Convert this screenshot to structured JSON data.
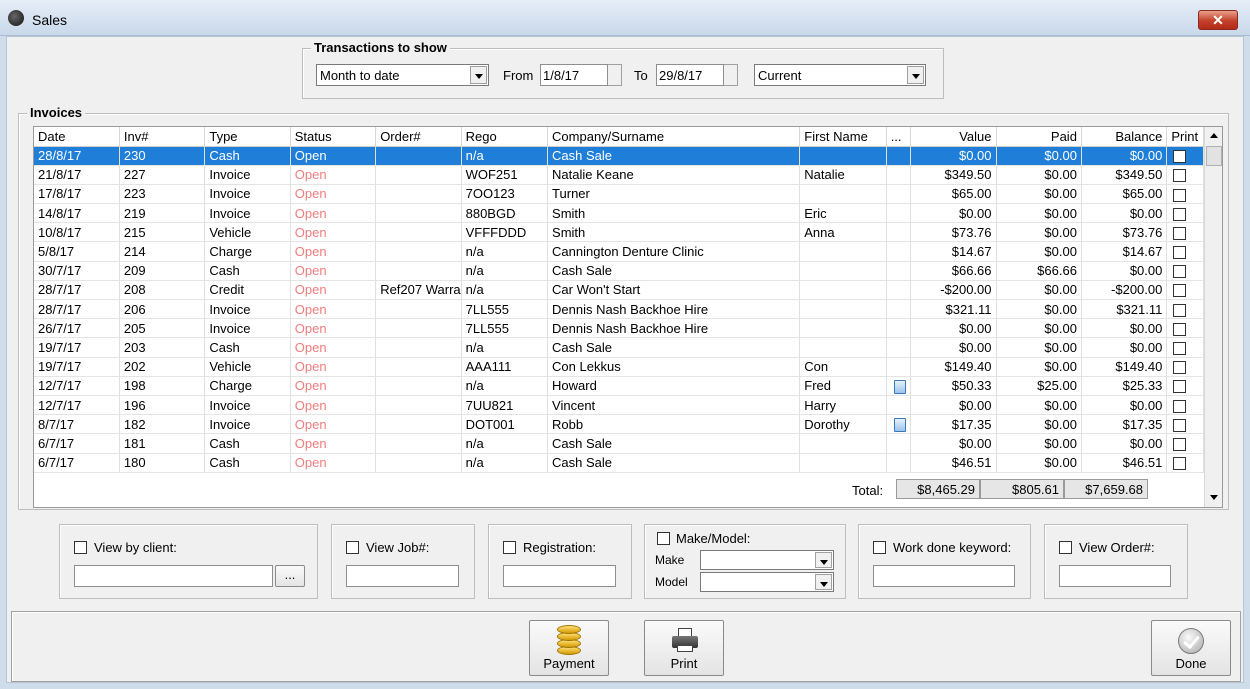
{
  "window": {
    "title": "Sales",
    "close_glyph": "✕"
  },
  "transactions": {
    "legend": "Transactions to show",
    "period": "Month to date",
    "from_label": "From",
    "from_value": "1/8/17",
    "to_label": "To",
    "to_value": "29/8/17",
    "scope": "Current"
  },
  "invoices": {
    "legend": "Invoices",
    "columns": [
      "Date",
      "Inv#",
      "Type",
      "Status",
      "Order#",
      "Rego",
      "Company/Surname",
      "First Name",
      "...",
      "Value",
      "Paid",
      "Balance",
      "Print"
    ],
    "rows": [
      {
        "date": "28/8/17",
        "inv": "230",
        "type": "Cash",
        "status": "Open",
        "order": "",
        "rego": "n/a",
        "company": "Cash Sale",
        "first": "",
        "doc": false,
        "value": "$0.00",
        "paid": "$0.00",
        "balance": "$0.00"
      },
      {
        "date": "21/8/17",
        "inv": "227",
        "type": "Invoice",
        "status": "Open",
        "order": "",
        "rego": "WOF251",
        "company": "Natalie Keane",
        "first": "Natalie",
        "doc": false,
        "value": "$349.50",
        "paid": "$0.00",
        "balance": "$349.50"
      },
      {
        "date": "17/8/17",
        "inv": "223",
        "type": "Invoice",
        "status": "Open",
        "order": "",
        "rego": "7OO123",
        "company": "Turner",
        "first": "",
        "doc": false,
        "value": "$65.00",
        "paid": "$0.00",
        "balance": "$65.00"
      },
      {
        "date": "14/8/17",
        "inv": "219",
        "type": "Invoice",
        "status": "Open",
        "order": "",
        "rego": "880BGD",
        "company": "Smith",
        "first": "Eric",
        "doc": false,
        "value": "$0.00",
        "paid": "$0.00",
        "balance": "$0.00"
      },
      {
        "date": "10/8/17",
        "inv": "215",
        "type": "Vehicle",
        "status": "Open",
        "order": "",
        "rego": "VFFFDDD",
        "company": "Smith",
        "first": "Anna",
        "doc": false,
        "value": "$73.76",
        "paid": "$0.00",
        "balance": "$73.76"
      },
      {
        "date": "5/8/17",
        "inv": "214",
        "type": "Charge",
        "status": "Open",
        "order": "",
        "rego": "n/a",
        "company": "Cannington Denture Clinic",
        "first": "",
        "doc": false,
        "value": "$14.67",
        "paid": "$0.00",
        "balance": "$14.67"
      },
      {
        "date": "30/7/17",
        "inv": "209",
        "type": "Cash",
        "status": "Open",
        "order": "",
        "rego": "n/a",
        "company": "Cash Sale",
        "first": "",
        "doc": false,
        "value": "$66.66",
        "paid": "$66.66",
        "balance": "$0.00"
      },
      {
        "date": "28/7/17",
        "inv": "208",
        "type": "Credit",
        "status": "Open",
        "order": "Ref207 Warra",
        "rego": "n/a",
        "company": "Car Won't Start",
        "first": "",
        "doc": false,
        "value": "-$200.00",
        "paid": "$0.00",
        "balance": "-$200.00"
      },
      {
        "date": "28/7/17",
        "inv": "206",
        "type": "Invoice",
        "status": "Open",
        "order": "",
        "rego": "7LL555",
        "company": "Dennis Nash Backhoe Hire",
        "first": "",
        "doc": false,
        "value": "$321.11",
        "paid": "$0.00",
        "balance": "$321.11"
      },
      {
        "date": "26/7/17",
        "inv": "205",
        "type": "Invoice",
        "status": "Open",
        "order": "",
        "rego": "7LL555",
        "company": "Dennis Nash Backhoe Hire",
        "first": "",
        "doc": false,
        "value": "$0.00",
        "paid": "$0.00",
        "balance": "$0.00"
      },
      {
        "date": "19/7/17",
        "inv": "203",
        "type": "Cash",
        "status": "Open",
        "order": "",
        "rego": "n/a",
        "company": "Cash Sale",
        "first": "",
        "doc": false,
        "value": "$0.00",
        "paid": "$0.00",
        "balance": "$0.00"
      },
      {
        "date": "19/7/17",
        "inv": "202",
        "type": "Vehicle",
        "status": "Open",
        "order": "",
        "rego": "AAA111",
        "company": "Con Lekkus",
        "first": "Con",
        "doc": false,
        "value": "$149.40",
        "paid": "$0.00",
        "balance": "$149.40"
      },
      {
        "date": "12/7/17",
        "inv": "198",
        "type": "Charge",
        "status": "Open",
        "order": "",
        "rego": "n/a",
        "company": "Howard",
        "first": "Fred",
        "doc": true,
        "value": "$50.33",
        "paid": "$25.00",
        "balance": "$25.33"
      },
      {
        "date": "12/7/17",
        "inv": "196",
        "type": "Invoice",
        "status": "Open",
        "order": "",
        "rego": "7UU821",
        "company": "Vincent",
        "first": "Harry",
        "doc": false,
        "value": "$0.00",
        "paid": "$0.00",
        "balance": "$0.00"
      },
      {
        "date": "8/7/17",
        "inv": "182",
        "type": "Invoice",
        "status": "Open",
        "order": "",
        "rego": "DOT001",
        "company": "Robb",
        "first": "Dorothy",
        "doc": true,
        "value": "$17.35",
        "paid": "$0.00",
        "balance": "$17.35"
      },
      {
        "date": "6/7/17",
        "inv": "181",
        "type": "Cash",
        "status": "Open",
        "order": "",
        "rego": "n/a",
        "company": "Cash Sale",
        "first": "",
        "doc": false,
        "value": "$0.00",
        "paid": "$0.00",
        "balance": "$0.00"
      },
      {
        "date": "6/7/17",
        "inv": "180",
        "type": "Cash",
        "status": "Open",
        "order": "",
        "rego": "n/a",
        "company": "Cash Sale",
        "first": "",
        "doc": false,
        "value": "$46.51",
        "paid": "$0.00",
        "balance": "$46.51"
      }
    ],
    "total_label": "Total:",
    "total_value": "$8,465.29",
    "total_paid": "$805.61",
    "total_balance": "$7,659.68"
  },
  "filters": {
    "client_label": "View by client:",
    "client_button": "...",
    "job_label": "View Job#:",
    "registration_label": "Registration:",
    "make_model_label": "Make/Model:",
    "make_label": "Make",
    "model_label": "Model",
    "keyword_label": "Work done keyword:",
    "order_label": "View Order#:"
  },
  "buttons": {
    "payment": "Payment",
    "print": "Print",
    "done": "Done"
  },
  "colors": {
    "selection": "#1f7fd8",
    "open_status": "#f07d7d"
  }
}
